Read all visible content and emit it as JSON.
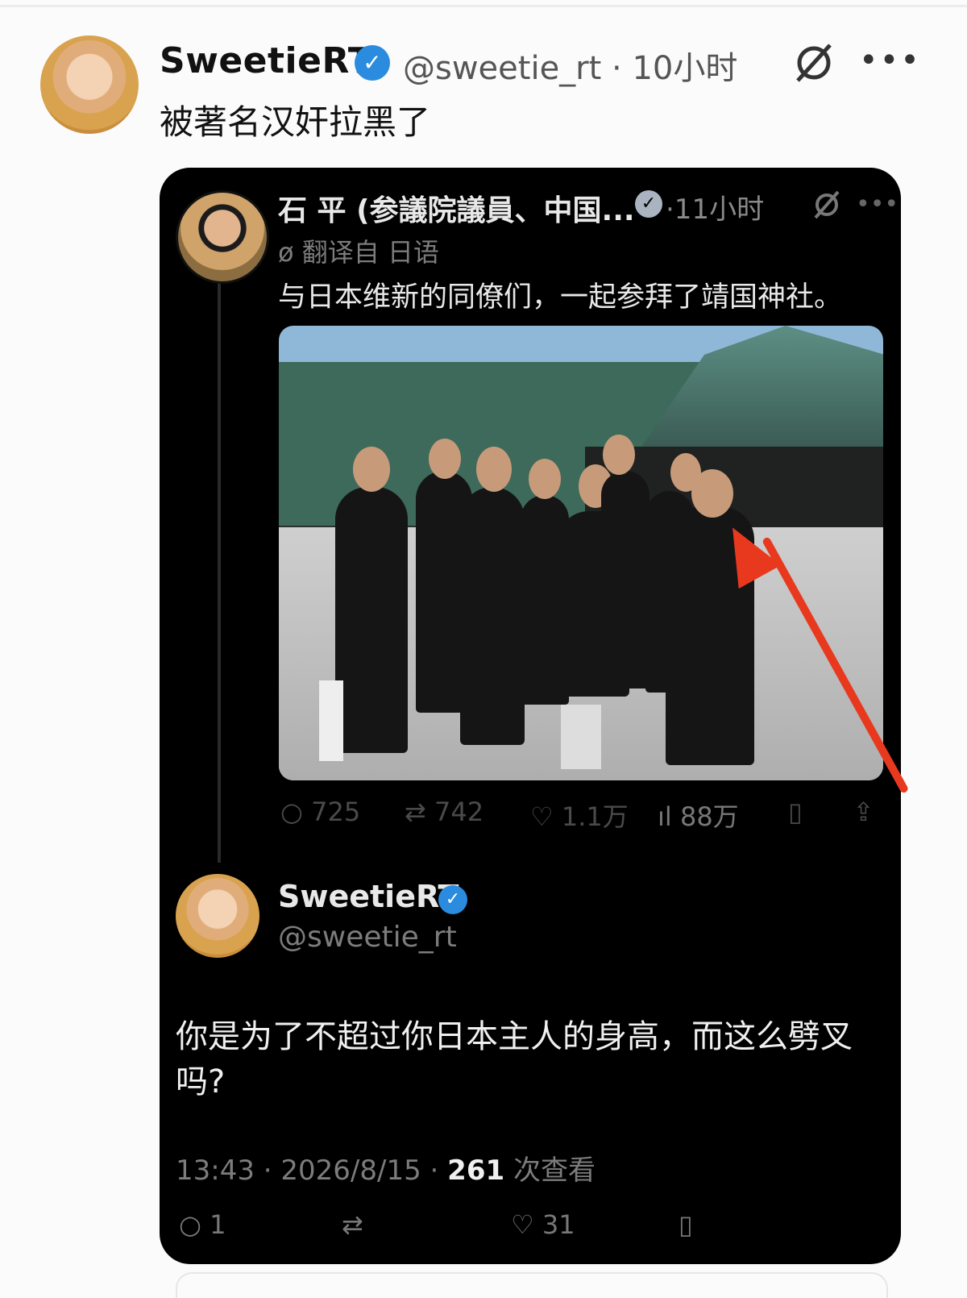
{
  "post": {
    "author_name": "SweetieRT",
    "handle_time": "@sweetie_rt · 10小时",
    "text": "被著名汉奸拉黑了",
    "icons": [
      "avatar",
      "verified-icon",
      "grok-icon",
      "more-icon"
    ]
  },
  "quoted": {
    "author_name": "石 平 (参議院議員、中国...",
    "time": "·11小时",
    "translated_label": "翻译自 日语",
    "text": "与日本维新的同僚们，一起参拜了靖国神社。",
    "stats": {
      "replies": "725",
      "reposts": "742",
      "likes": "1.1万",
      "views": "88万"
    }
  },
  "reply": {
    "author_name": "SweetieRT",
    "handle": "@sweetie_rt",
    "text": "你是为了不超过你日本主人的身高，而这么劈叉吗?",
    "time_date": "13:43 · 2026/8/15 · ",
    "views_count": "261",
    "views_label": " 次查看",
    "stats": {
      "replies": "1",
      "reposts": "",
      "likes": "31"
    }
  },
  "colors": {
    "verified": "#2a8bdf",
    "arrow": "#e8391f",
    "card_bg": "#000000"
  }
}
